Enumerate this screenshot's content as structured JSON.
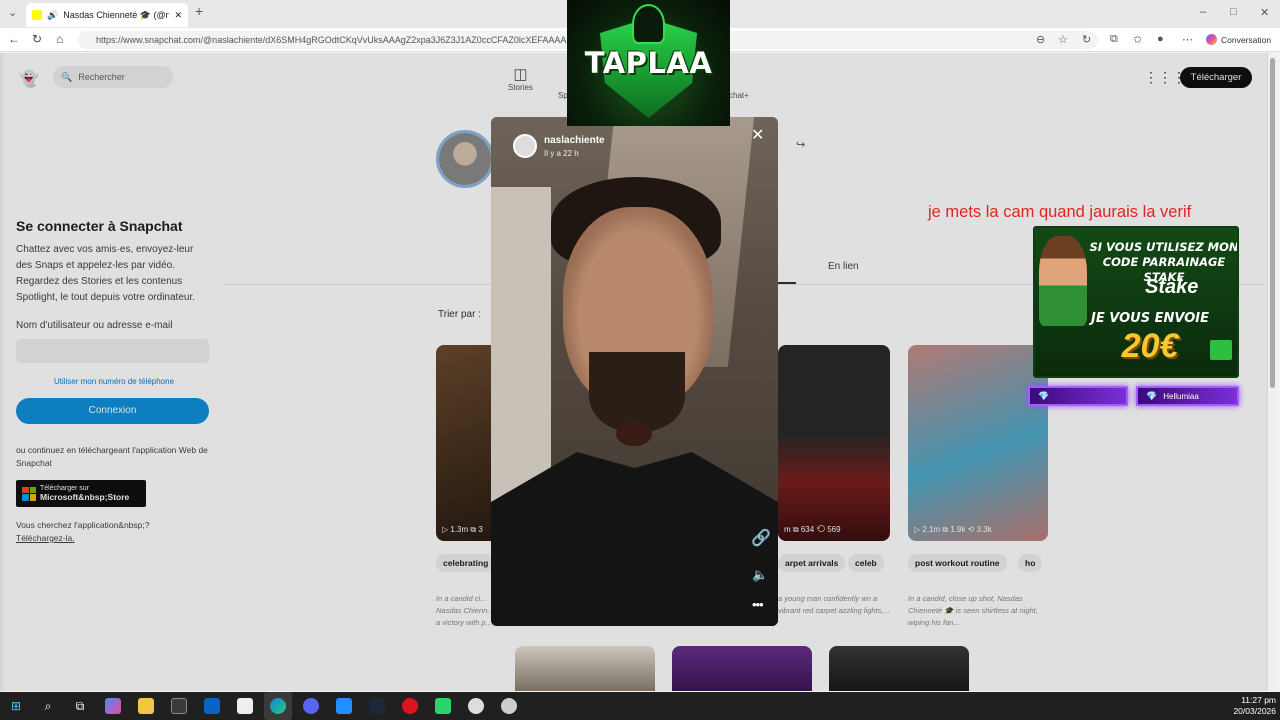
{
  "browser": {
    "tab_title": "Nasdas Chienneté 🎓 (@nasl",
    "url": "https://www.snapchat.com/@naslachiente/dX6SMH4gRGOdtCKqVvUksAAAgZ2xpa3J6Z3J1AZ0ccCFAZ0lcXEFAAAA",
    "conversation_label": "Conversation"
  },
  "snapchat": {
    "search_placeholder": "Rechercher",
    "nav": [
      {
        "label": "Stories"
      },
      {
        "label": "Sp"
      },
      {
        "label": "chat+"
      }
    ],
    "download_button": "Télécharger",
    "login": {
      "title": "Se connecter à Snapchat",
      "description": "Chattez avec vos amis·es, envoyez-leur des Snaps et appelez-les par vidéo. Regardez des Stories et les contenus Spotlight, le tout depuis votre ordinateur.",
      "field_label": "Nom d'utilisateur ou adresse e-mail",
      "phone_link": "Utiliser mon numéro de téléphone",
      "connect_button": "Connexion",
      "alt_text": "ou continuez en téléchargeant l'application Web de Snapchat",
      "store_small": "Télécharger sur",
      "store_big": "Microsoft&nbsp;Store",
      "find_text": "Vous cherchez l'application&nbsp;?",
      "find_link": "Téléchargez-la."
    },
    "tab_enlien": "En lien",
    "sort_label": "Trier par :",
    "cards": [
      {
        "stats": "▷ 1.3m  ⧉ 3",
        "chip": "celebrating",
        "desc": "In a candid cl... Nasdas Chienn... a victory with p..."
      },
      {
        "stats": "m  ⧉ 634  ⟲ 569",
        "chip": "arpet arrivals",
        "chip2": "celeb",
        "desc": "a young man confidently wn a vibrant red carpet azzling lights,..."
      },
      {
        "stats": "▷ 2.1m  ⧉ 1.9k  ⟲ 3.3k",
        "chip": "post workout routine",
        "chip2": "ho",
        "desc": "In a candid, close up shot, Nasdas Chienneté 🎓 is seen shirtless at night, wiping his fan..."
      }
    ]
  },
  "story": {
    "username": "naslachiente",
    "time": "Il y a 22 h"
  },
  "stream": {
    "logo_text": "TAPLAA",
    "overlay_text": "je mets la cam quand jaurais la verif",
    "ad": {
      "line1": "SI VOUS UTILISEZ MON CODE PARRAINAGE STAKE",
      "brand": "Stake",
      "line2": "JE VOUS ENVOIE",
      "amount": "20€"
    },
    "sub_name": "Hellumiaa"
  },
  "taskbar": {
    "time": "11:27 pm",
    "date": "20/03/2026"
  }
}
